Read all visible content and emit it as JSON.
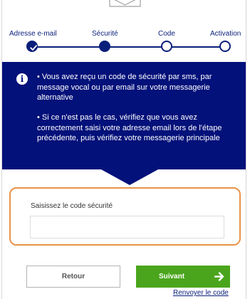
{
  "stepper": {
    "steps": [
      {
        "label": "Adresse e-mail",
        "state": "done"
      },
      {
        "label": "Sécurité",
        "state": "current"
      },
      {
        "label": "Code",
        "state": "pending"
      },
      {
        "label": "Activation",
        "state": "pending"
      }
    ]
  },
  "info": {
    "icon": "info-icon",
    "paragraph_1": "• Vous avez reçu un code de sécurité par sms, par message vocal ou par email sur votre messagerie alternative",
    "paragraph_2": "• Si ce n'est pas le cas, vérifiez que vous avez correctement saisi votre adresse email lors de l'étape précédente, puis vérifiez votre messagerie principale"
  },
  "code_field": {
    "label": "Saisissez le code sécurité",
    "value": "",
    "placeholder": ""
  },
  "buttons": {
    "back_label": "Retour",
    "next_label": "Suivant",
    "resend_label": "Renvoyer le code"
  },
  "colors": {
    "primary_navy": "#03117a",
    "success_green": "#4aa51c",
    "highlight_orange": "#e8934a"
  }
}
